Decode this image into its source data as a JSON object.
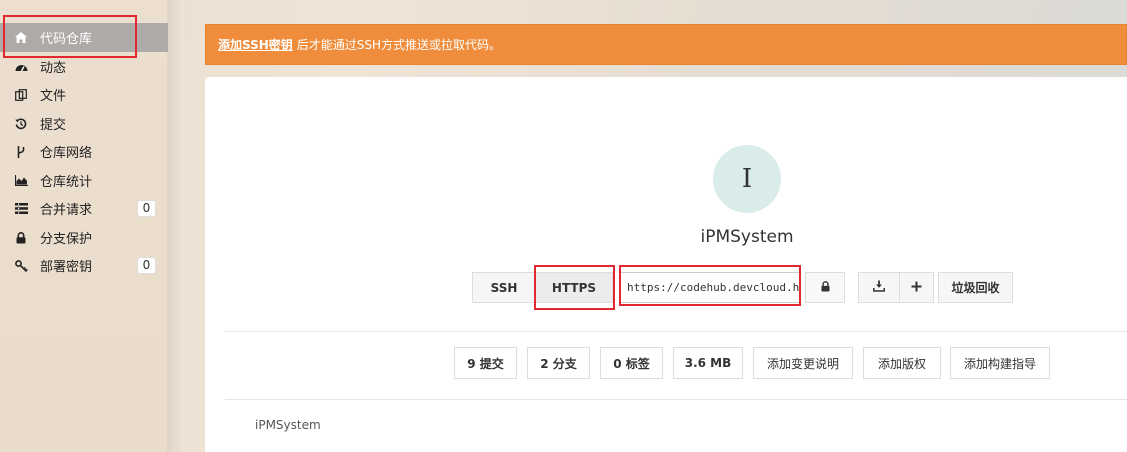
{
  "sidebar": {
    "items": [
      {
        "label": "代码仓库",
        "icon": "home-icon",
        "badge": ""
      },
      {
        "label": "动态",
        "icon": "dashboard-icon",
        "badge": ""
      },
      {
        "label": "文件",
        "icon": "files-icon",
        "badge": ""
      },
      {
        "label": "提交",
        "icon": "history-icon",
        "badge": ""
      },
      {
        "label": "仓库网络",
        "icon": "branch-network-icon",
        "badge": ""
      },
      {
        "label": "仓库统计",
        "icon": "area-chart-icon",
        "badge": ""
      },
      {
        "label": "合并请求",
        "icon": "merge-request-icon",
        "badge": "0"
      },
      {
        "label": "分支保护",
        "icon": "lock-icon",
        "badge": ""
      },
      {
        "label": "部署密钥",
        "icon": "key-icon",
        "badge": "0"
      }
    ]
  },
  "alert": {
    "link": "添加SSH密钥",
    "text": "后才能通过SSH方式推送或拉取代码。",
    "color": "#f08d3c"
  },
  "repo": {
    "avatar_letter": "I",
    "name": "iPMSystem",
    "clone": {
      "ssh_label": "SSH",
      "https_label": "HTTPS",
      "url": "https://codehub.devcloud.huaweicloud.com"
    },
    "actions": {
      "download_icon": "download-icon",
      "add_icon": "plus-icon",
      "trash_label": "垃圾回收"
    },
    "stats": {
      "commits": "9 提交",
      "branches": "2 分支",
      "tags": "0 标签",
      "size": "3.6 MB",
      "add_changelog": "添加变更说明",
      "add_license": "添加版权",
      "add_build_guide": "添加构建指导"
    },
    "readme_title": "iPMSystem"
  }
}
